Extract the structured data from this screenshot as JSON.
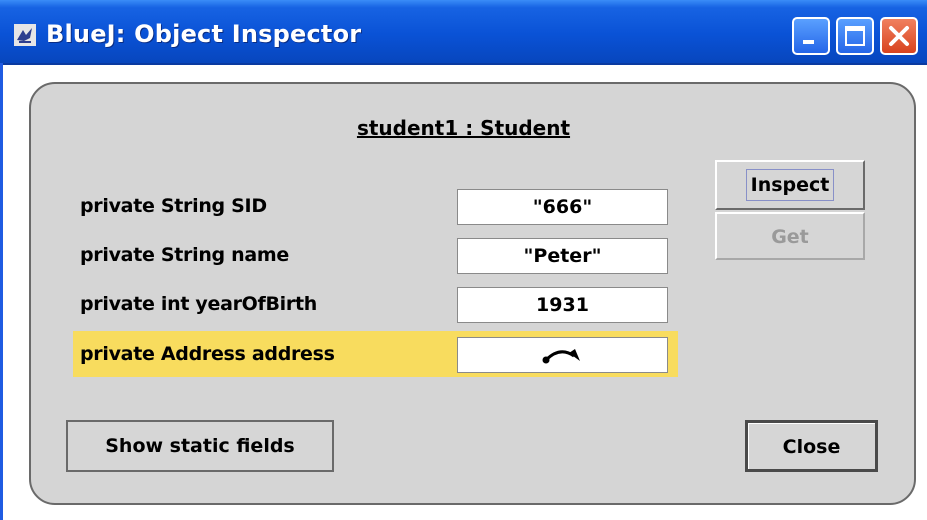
{
  "window": {
    "title": "BlueJ:  Object Inspector",
    "titlebar_color": "#0a52d6"
  },
  "object": {
    "title": "student1 : Student"
  },
  "fields": [
    {
      "label": "private String SID",
      "value": "\"666\""
    },
    {
      "label": "private String name",
      "value": "\"Peter\""
    },
    {
      "label": "private int yearOfBirth",
      "value": "1931"
    },
    {
      "label": "private Address address",
      "value": "",
      "value_icon": "object-reference-arrow-icon",
      "selected": true,
      "highlight_color": "#f8dc5e"
    }
  ],
  "buttons": {
    "inspect": "Inspect",
    "get": "Get",
    "show_static": "Show static fields",
    "close": "Close"
  }
}
